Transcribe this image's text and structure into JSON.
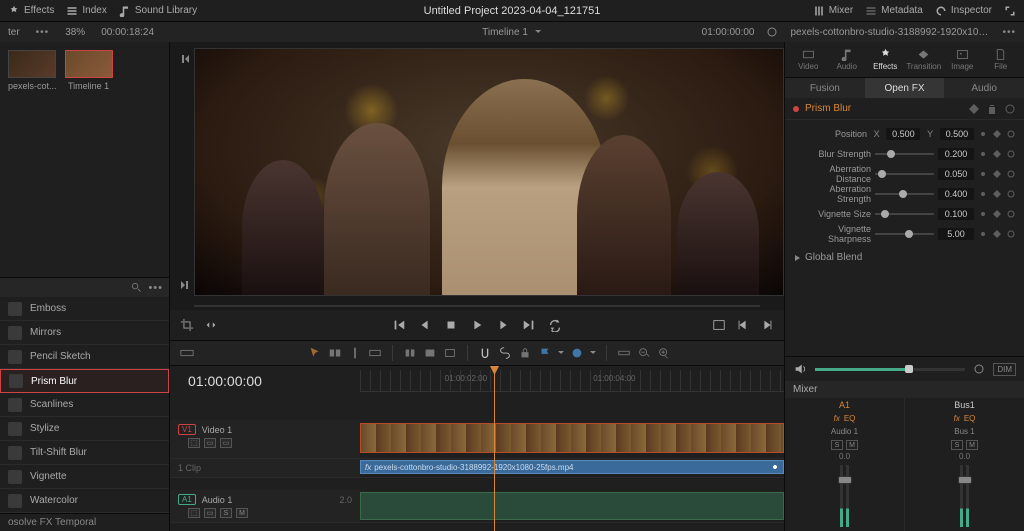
{
  "topbar": {
    "effects": "Effects",
    "index": "Index",
    "sound": "Sound Library",
    "mixer": "Mixer",
    "metadata": "Metadata",
    "inspector": "Inspector"
  },
  "project_title": "Untitled Project 2023-04-04_121751",
  "subbar": {
    "zoom": "38%",
    "tc_left": "00:00:18:24",
    "timeline_name": "Timeline 1",
    "tc_right": "01:00:00:00",
    "clip_name": "pexels-cottonbro-studio-3188992-1920x1080-25fps.mp4"
  },
  "media": {
    "thumb1": "pexels-cot...",
    "thumb2": "Timeline 1"
  },
  "fx_list": [
    "Emboss",
    "Mirrors",
    "Pencil Sketch",
    "Prism Blur",
    "Scanlines",
    "Stylize",
    "Tilt-Shift Blur",
    "Vignette",
    "Watercolor"
  ],
  "fx_selected": "Prism Blur",
  "fx_category": "osolve FX Temporal",
  "timeline": {
    "tc": "01:00:00:00",
    "ticks": [
      "01:00:02:00",
      "01:00:04:00"
    ],
    "video_track": "Video 1",
    "video_sub": "1 Clip",
    "audio_track": "Audio 1",
    "audio_ch": "2.0",
    "v_badge": "V1",
    "a_badge": "A1",
    "fx_clip": "pexels-cottonbro-studio-3188992-1920x1080-25fps.mp4"
  },
  "inspector": {
    "tabs": [
      "Video",
      "Audio",
      "Effects",
      "Transition",
      "Image",
      "File"
    ],
    "tab_active": "Effects",
    "subtabs": [
      "Fusion",
      "Open FX",
      "Audio"
    ],
    "subtab_active": "Open FX",
    "fx_name": "Prism Blur",
    "pos_label": "Position",
    "pos_x": "0.500",
    "pos_y": "0.500",
    "params": [
      {
        "label": "Blur Strength",
        "val": "0.200",
        "knob": 20
      },
      {
        "label": "Aberration Distance",
        "val": "0.050",
        "knob": 5
      },
      {
        "label": "Aberration Strength",
        "val": "0.400",
        "knob": 40
      },
      {
        "label": "Vignette Size",
        "val": "0.100",
        "knob": 10
      },
      {
        "label": "Vignette Sharpness",
        "val": "5.00",
        "knob": 50
      }
    ],
    "global_blend": "Global Blend"
  },
  "mixer": {
    "title": "Mixer",
    "dim": "DIM",
    "channels": [
      {
        "name": "A1",
        "fx": [
          "fx",
          "EQ"
        ],
        "type": "Audio 1",
        "db": "0.0"
      },
      {
        "name": "Bus1",
        "fx": [
          "fx",
          "EQ"
        ],
        "type": "Bus 1",
        "db": "0.0"
      }
    ],
    "s": "S",
    "m": "M"
  }
}
